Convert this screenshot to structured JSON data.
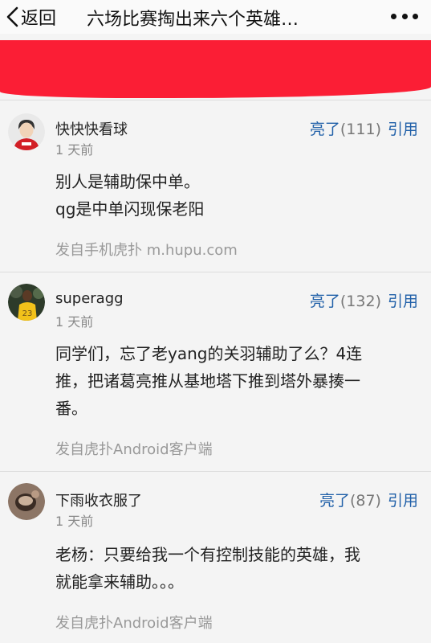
{
  "nav": {
    "back_label": "返回",
    "title": "六场比赛掏出来六个英雄…"
  },
  "comments": [
    {
      "username": "快快快看球",
      "time": "1 天前",
      "like_label": "亮了",
      "like_count": "(111)",
      "quote_label": "引用",
      "lines": [
        "别人是辅助保中单。",
        "qg是中单闪现保老阳"
      ],
      "source": "发自手机虎扑 m.hupu.com"
    },
    {
      "username": "superagg",
      "time": "1 天前",
      "like_label": "亮了",
      "like_count": "(132)",
      "quote_label": "引用",
      "lines": [
        "同学们，忘了老yang的关羽辅助了么？4连",
        "推，把诸葛亮推从基地塔下推到塔外暴揍一",
        "番。"
      ],
      "source": "发自虎扑Android客户端"
    },
    {
      "username": "下雨收衣服了",
      "time": "1 天前",
      "like_label": "亮了",
      "like_count": "(87)",
      "quote_label": "引用",
      "lines": [
        "老杨：只要给我一个有控制技能的英雄，我",
        "就能拿来辅助。。。"
      ],
      "source": "发自虎扑Android客户端"
    }
  ],
  "colors": {
    "banner": "#fb1e35",
    "action_blue": "#1f5fa8",
    "background": "#f4f4f4"
  },
  "icons": [
    "back-chevron-icon",
    "more-dots-icon"
  ]
}
